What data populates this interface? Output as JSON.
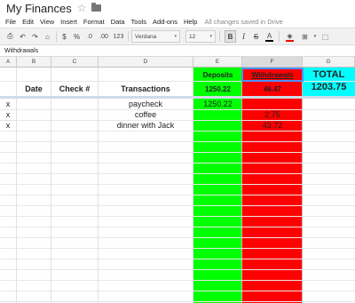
{
  "app": {
    "title": "My Finances",
    "star_glyph": "☆",
    "menu": [
      "File",
      "Edit",
      "View",
      "Insert",
      "Format",
      "Data",
      "Tools",
      "Add-ons",
      "Help"
    ],
    "save_status": "All changes saved in Drive"
  },
  "toolbar": {
    "print_glyph": "⎙",
    "undo_glyph": "↶",
    "redo_glyph": "↷",
    "paint_format_glyph": "⌂",
    "currency": "$",
    "percent": "%",
    "decrease_decimals": ".0",
    "increase_decimals": ".00",
    "more_formats": "123",
    "font_family": "Verdana",
    "font_size": "12",
    "bold": "B",
    "italic": "I",
    "strikethrough": "S",
    "text_color": "A",
    "text_color_value": "#000000",
    "fill_glyph": "◈",
    "fill_color_value": "#ff0000",
    "borders_glyph": "⊞",
    "merge_glyph": "⬚",
    "caret": "▾"
  },
  "formula_bar": {
    "value": "Withdrawals"
  },
  "columns": [
    "A",
    "B",
    "C",
    "D",
    "E",
    "F",
    "G"
  ],
  "selected_column": "F",
  "colors": {
    "deposits_fill": "#00ff00",
    "withdrawals_fill": "#ff0000",
    "total_fill": "#00ffff",
    "selection": "#4d90fe"
  },
  "sheet": {
    "header": {
      "deposits": "Deposits",
      "withdrawals": "Withdrawals",
      "total": "TOTAL",
      "date": "Date",
      "check": "Check #",
      "transactions": "Transactions",
      "deposits_sum": "1250.22",
      "withdrawals_sum": "46.47",
      "total_value": "1203.75"
    },
    "rows": [
      {
        "mark": "x",
        "transaction": "paycheck",
        "deposit": "1250.22",
        "withdrawal": ""
      },
      {
        "mark": "x",
        "transaction": "coffee",
        "deposit": "",
        "withdrawal": "2.75"
      },
      {
        "mark": "x",
        "transaction": "dinner with Jack",
        "deposit": "",
        "withdrawal": "43.72"
      }
    ]
  }
}
